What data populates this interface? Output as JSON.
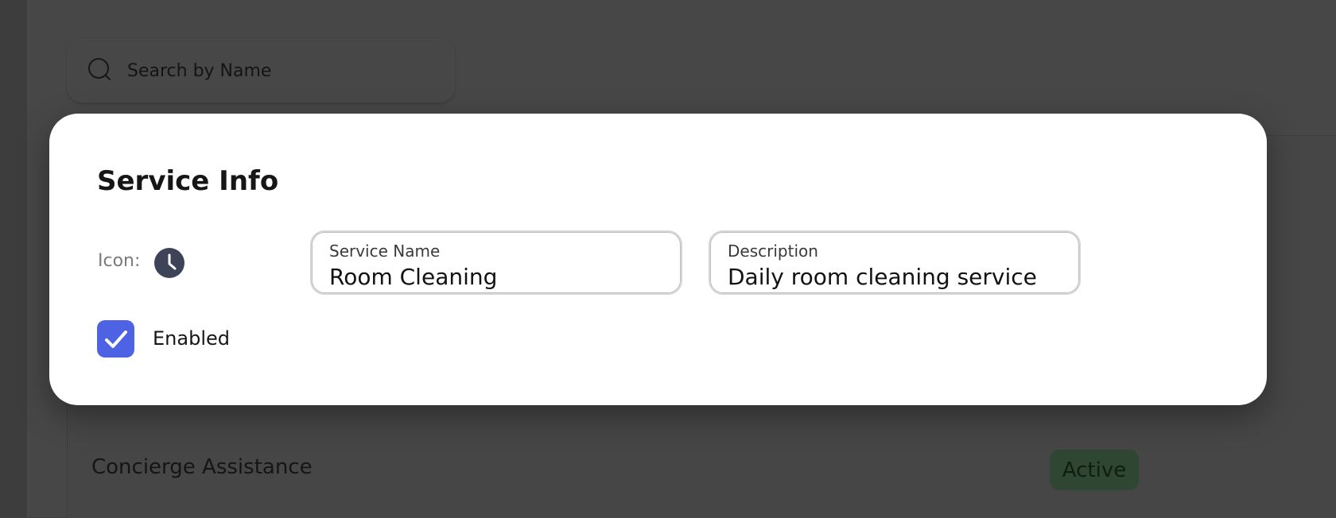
{
  "search": {
    "placeholder": "Search by Name"
  },
  "table": {
    "rows": [
      {
        "name": "Concierge Assistance",
        "status": "Active"
      }
    ]
  },
  "modal": {
    "title": "Service Info",
    "icon_label": "Icon:",
    "icon_name": "clock-icon",
    "service_name": {
      "label": "Service Name",
      "value": "Room Cleaning"
    },
    "description": {
      "label": "Description",
      "value": "Daily room cleaning service"
    },
    "enabled": {
      "label": "Enabled",
      "checked": true
    }
  },
  "colors": {
    "checkbox_accent": "#4d63e3",
    "icon_circle": "#3d4457",
    "status_active_bg": "#2f4632",
    "modal_bg": "#ffffff",
    "backdrop": "#414141"
  }
}
